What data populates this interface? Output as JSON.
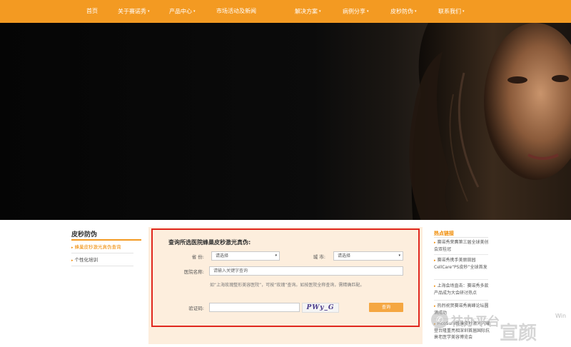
{
  "nav": {
    "items": [
      {
        "label": "首页",
        "has_dropdown": false
      },
      {
        "label": "关于赛诺秀",
        "has_dropdown": true
      },
      {
        "label": "产品中心",
        "has_dropdown": true
      },
      {
        "label": "市场活动及新闻",
        "has_dropdown": false
      },
      {
        "label": "解决方案",
        "has_dropdown": true
      },
      {
        "label": "病例分享",
        "has_dropdown": true
      },
      {
        "label": "皮秒防伪",
        "has_dropdown": true
      },
      {
        "label": "联系我们",
        "has_dropdown": true
      }
    ],
    "caret": "▾",
    "bg_color": "#f39a22"
  },
  "sidebar": {
    "title": "皮秒防伪",
    "items": [
      {
        "label": "蜂巢皮秒激光真伪查询",
        "active": true
      },
      {
        "label": "个性化培训",
        "active": false
      }
    ],
    "arrow": "▸"
  },
  "form": {
    "title": "查询所选医院蜂巢皮秒激光真伪:",
    "province_label": "省  份:",
    "province_value": "请选择",
    "city_label": "城  市:",
    "city_value": "请选择",
    "hospital_label": "医院名称:",
    "hospital_placeholder": "请输入关键字查询",
    "hint": "如“上海玫瑰整形美容医院”，可按“玫瑰”查询。如按医院全称查询，需精确匹配。",
    "captcha_label": "验证码:",
    "captcha_text": "PWy_G",
    "query_button": "查询",
    "highlight_color": "#e0281f"
  },
  "hot_links": {
    "title": "热点链接",
    "items": [
      "赛诺秀荣膺第三届全球美创会双桂冠",
      "赛诺秀携手美丽田园CellCare“PS皮秒”全球首发",
      "上海会场直击：赛诺秀多款产品成为大会研讨热点",
      "热烈祝贺赛诺秀高峰论坛圆满成功",
      "PicoSure蜂巢皮秒激光闪耀登台隆重亮相深圳首届国际抗衰老医学美容博览会"
    ],
    "arrow": "▸"
  },
  "watermark": {
    "icon": "chat-bubble-icon",
    "text": "祛办平台",
    "big": "宣颜",
    "corner": "Win"
  }
}
